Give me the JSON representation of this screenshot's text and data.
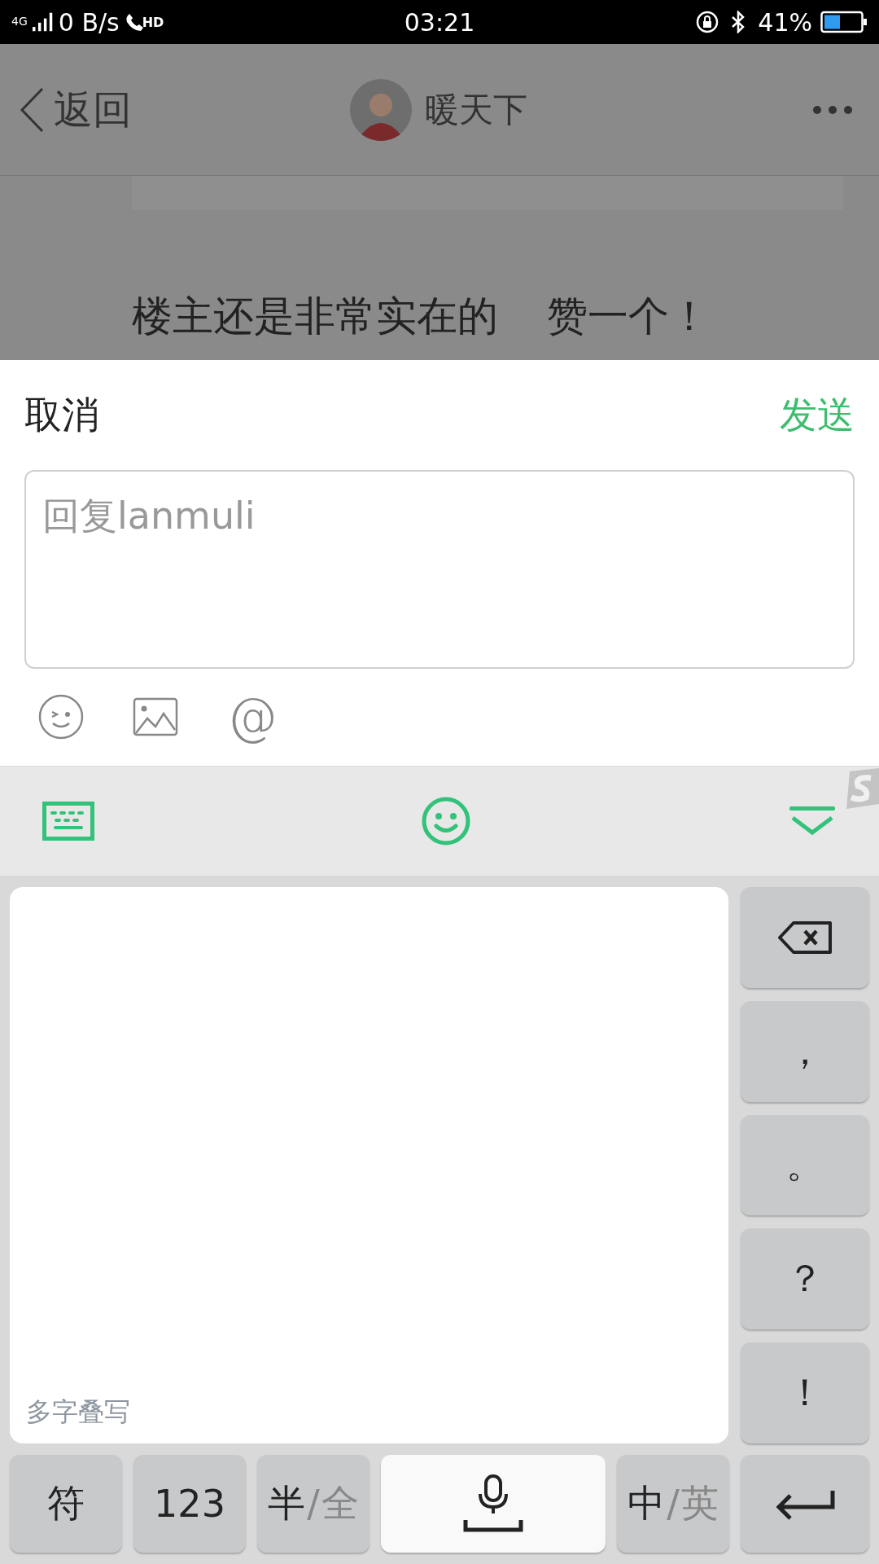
{
  "status_bar": {
    "network": "4G",
    "speed": "0 B/s",
    "call": "HD",
    "time": "03:21",
    "battery": "41%"
  },
  "header": {
    "back": "返回",
    "title": "暖天下"
  },
  "background_comment": [
    "楼主还是非常实在的",
    "赞一个！"
  ],
  "reply_sheet": {
    "cancel": "取消",
    "send": "发送",
    "input": {
      "placeholder": "回复lanmuli"
    },
    "tools": [
      {
        "kind": "emoji"
      },
      {
        "kind": "image"
      },
      {
        "kind": "mention",
        "glyph": "@"
      }
    ]
  },
  "keyboard": {
    "toolbar": [
      {
        "kind": "keyboard"
      },
      {
        "kind": "emoji"
      },
      {
        "kind": "hide"
      }
    ],
    "handwriting_hint": "多字叠写",
    "side_keys": [
      {
        "kind": "backspace"
      },
      {
        "kind": "char",
        "label": "，"
      },
      {
        "kind": "char",
        "label": "。"
      },
      {
        "kind": "char",
        "label": "？"
      },
      {
        "kind": "char",
        "label": "！"
      }
    ],
    "bottom_keys": [
      {
        "kind": "text",
        "label": "符"
      },
      {
        "kind": "text",
        "label": "123"
      },
      {
        "kind": "toggle",
        "separator": "/",
        "parts": [
          {
            "label": "半",
            "selected": true
          },
          {
            "label": "全",
            "selected": false
          }
        ]
      },
      {
        "kind": "space"
      },
      {
        "kind": "toggle",
        "separator": "/",
        "parts": [
          {
            "label": "中",
            "selected": true
          },
          {
            "label": "英",
            "selected": false
          }
        ]
      },
      {
        "kind": "enter"
      }
    ]
  }
}
